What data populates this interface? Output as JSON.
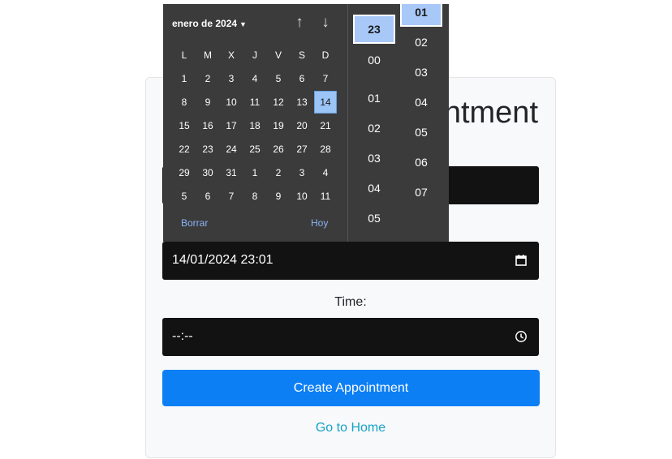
{
  "form": {
    "title_partial": "ntment",
    "datetime_value": "14/01/2024 23:01",
    "time_label": "Time:",
    "time_value": "--:--",
    "create_button": "Create Appointment",
    "home_link": "Go to Home"
  },
  "picker": {
    "month_label": "enero de 2024",
    "nav_up": "↑",
    "nav_down": "↓",
    "weekdays": [
      "L",
      "M",
      "X",
      "J",
      "V",
      "S",
      "D"
    ],
    "weeks": [
      [
        "1",
        "2",
        "3",
        "4",
        "5",
        "6",
        "7"
      ],
      [
        "8",
        "9",
        "10",
        "11",
        "12",
        "13",
        "14"
      ],
      [
        "15",
        "16",
        "17",
        "18",
        "19",
        "20",
        "21"
      ],
      [
        "22",
        "23",
        "24",
        "25",
        "26",
        "27",
        "28"
      ],
      [
        "29",
        "30",
        "31",
        "1",
        "2",
        "3",
        "4"
      ],
      [
        "5",
        "6",
        "7",
        "8",
        "9",
        "10",
        "11"
      ]
    ],
    "selected_day": "14",
    "clear_label": "Borrar",
    "today_label": "Hoy",
    "hours": [
      "23",
      "00",
      "01",
      "02",
      "03",
      "04",
      "05"
    ],
    "selected_hour": "23",
    "minutes": [
      "01",
      "02",
      "03",
      "04",
      "05",
      "06",
      "07"
    ],
    "selected_minute": "01"
  },
  "colors": {
    "accent_button": "#0d7ff5",
    "link": "#17a2c8",
    "selection": "#9bc4f7",
    "picker_bg": "#3b3b3b",
    "field_bg": "#121212"
  }
}
